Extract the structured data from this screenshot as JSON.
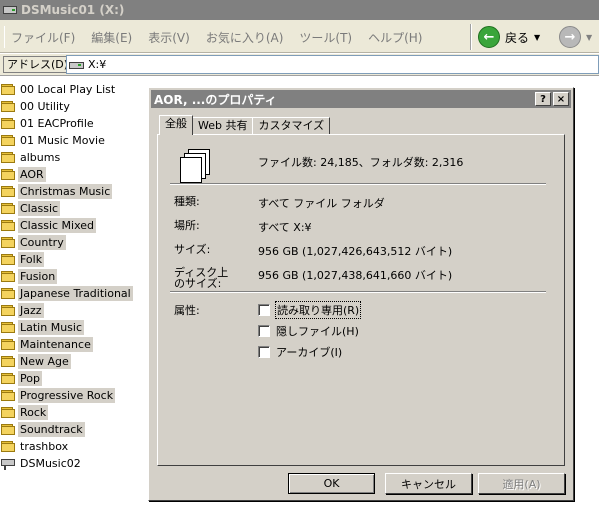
{
  "window": {
    "title": "DSMusic01 (X:)"
  },
  "menubar": {
    "items": [
      "ファイル(F)",
      "編集(E)",
      "表示(V)",
      "お気に入り(A)",
      "ツール(T)",
      "ヘルプ(H)"
    ],
    "back_label": "戻る"
  },
  "address": {
    "label": "アドレス(D)",
    "value": "X:¥"
  },
  "tree": {
    "items": [
      {
        "label": "00 Local Play List",
        "icon": "folder-icon",
        "selected": false
      },
      {
        "label": "00 Utility",
        "icon": "folder-icon",
        "selected": false
      },
      {
        "label": "01 EACProfile",
        "icon": "folder-icon",
        "selected": false
      },
      {
        "label": "01 Music Movie",
        "icon": "folder-icon",
        "selected": false
      },
      {
        "label": "albums",
        "icon": "folder-icon",
        "selected": false
      },
      {
        "label": "AOR",
        "icon": "folder-icon",
        "selected": true
      },
      {
        "label": "Christmas Music",
        "icon": "folder-icon",
        "selected": true
      },
      {
        "label": "Classic",
        "icon": "folder-icon",
        "selected": true
      },
      {
        "label": "Classic Mixed",
        "icon": "folder-icon",
        "selected": true
      },
      {
        "label": "Country",
        "icon": "folder-icon",
        "selected": true
      },
      {
        "label": "Folk",
        "icon": "folder-icon",
        "selected": true
      },
      {
        "label": "Fusion",
        "icon": "folder-icon",
        "selected": true
      },
      {
        "label": "Japanese Traditional",
        "icon": "folder-icon",
        "selected": true
      },
      {
        "label": "Jazz",
        "icon": "folder-icon",
        "selected": true
      },
      {
        "label": "Latin Music",
        "icon": "folder-icon",
        "selected": true
      },
      {
        "label": "Maintenance",
        "icon": "folder-icon",
        "selected": true
      },
      {
        "label": "New Age",
        "icon": "folder-icon",
        "selected": true
      },
      {
        "label": "Pop",
        "icon": "folder-icon",
        "selected": true
      },
      {
        "label": "Progressive Rock",
        "icon": "folder-icon",
        "selected": true
      },
      {
        "label": "Rock",
        "icon": "folder-icon",
        "selected": true
      },
      {
        "label": "Soundtrack",
        "icon": "folder-icon",
        "selected": true
      },
      {
        "label": "trashbox",
        "icon": "folder-icon",
        "selected": false
      },
      {
        "label": "DSMusic02",
        "icon": "network-drive-icon",
        "selected": false
      }
    ]
  },
  "dialog": {
    "title": "AOR, ...のプロパティ",
    "help_btn": "?",
    "close_btn": "×",
    "tabs": [
      "全般",
      "Web 共有",
      "カスタマイズ"
    ],
    "summary": "ファイル数: 24,185、フォルダ数: 2,316",
    "type_label": "種類:",
    "type_value": "すべて ファイル フォルダ",
    "location_label": "場所:",
    "location_value": "すべて X:¥",
    "size_label": "サイズ:",
    "size_value": "956 GB (1,027,426,643,512 バイト)",
    "disk_size_label_1": "ディスク上",
    "disk_size_label_2": "のサイズ:",
    "disk_size_value": "956 GB (1,027,438,641,660 バイト)",
    "attributes_label": "属性:",
    "attributes": [
      {
        "label": "読み取り専用(R)",
        "checked": false
      },
      {
        "label": "隠しファイル(H)",
        "checked": false
      },
      {
        "label": "アーカイブ(I)",
        "checked": false
      }
    ],
    "ok_label": "OK",
    "cancel_label": "キャンセル",
    "apply_label": "適用(A)"
  }
}
